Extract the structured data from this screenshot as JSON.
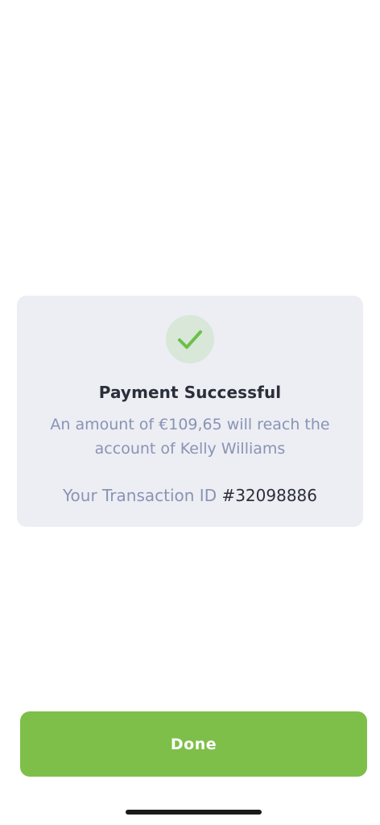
{
  "confirmation": {
    "icon": "checkmark-icon",
    "title": "Payment Successful",
    "message": "An amount of €109,65 will reach the account of Kelly Williams",
    "transaction_label": "Your Transaction ID",
    "transaction_id": "#32098886"
  },
  "actions": {
    "done_label": "Done"
  },
  "colors": {
    "accent": "#7ebf4a",
    "card_background": "#eceef3",
    "icon_background": "#d8e7d8",
    "muted_text": "#8a93b5",
    "primary_text": "#2b2f3a"
  }
}
